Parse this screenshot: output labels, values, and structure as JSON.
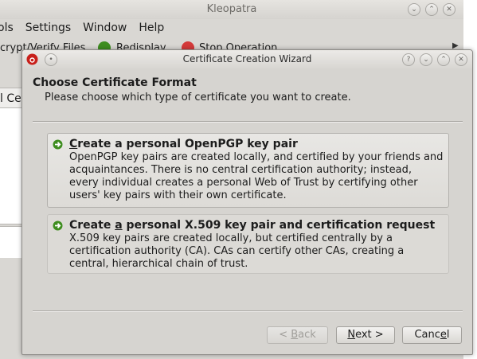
{
  "background_window": {
    "title": "Kleopatra",
    "menu": [
      "ols",
      "Settings",
      "Window",
      "Help"
    ],
    "toolbar": {
      "decrypt_label": "crypt/Verify Files",
      "redisplay_label": "Redisplay",
      "stop_label": "Stop Operation"
    },
    "tab_label": "l Ce"
  },
  "dialog": {
    "title": "Certificate Creation Wizard",
    "header_title": "Choose Certificate Format",
    "header_subtitle": "Please choose which type of certificate you want to create.",
    "options": [
      {
        "title_pre": "",
        "title_ul": "C",
        "title_post": "reate a personal OpenPGP key pair",
        "description": "OpenPGP key pairs are created locally, and certified by your friends and acquaintances. There is no central certification authority; instead, every individual creates a personal Web of Trust by certifying other users' key pairs with their own certificate."
      },
      {
        "title_pre": "Create ",
        "title_ul": "a",
        "title_post": " personal X.509 key pair and certification request",
        "description": "X.509 key pairs are created locally, but certified centrally by a certification authority (CA). CAs can certify other CAs, creating a central, hierarchical chain of trust."
      }
    ],
    "buttons": {
      "back_pre": "< ",
      "back_ul": "B",
      "back_post": "ack",
      "next_pre": "",
      "next_ul": "N",
      "next_post": "ext >",
      "cancel_pre": "Canc",
      "cancel_ul": "e",
      "cancel_post": "l"
    }
  },
  "colors": {
    "dialog_bg": "#d6d4d0",
    "arrow_green": "#3e8d1f",
    "app_icon_red": "#c8201b"
  }
}
